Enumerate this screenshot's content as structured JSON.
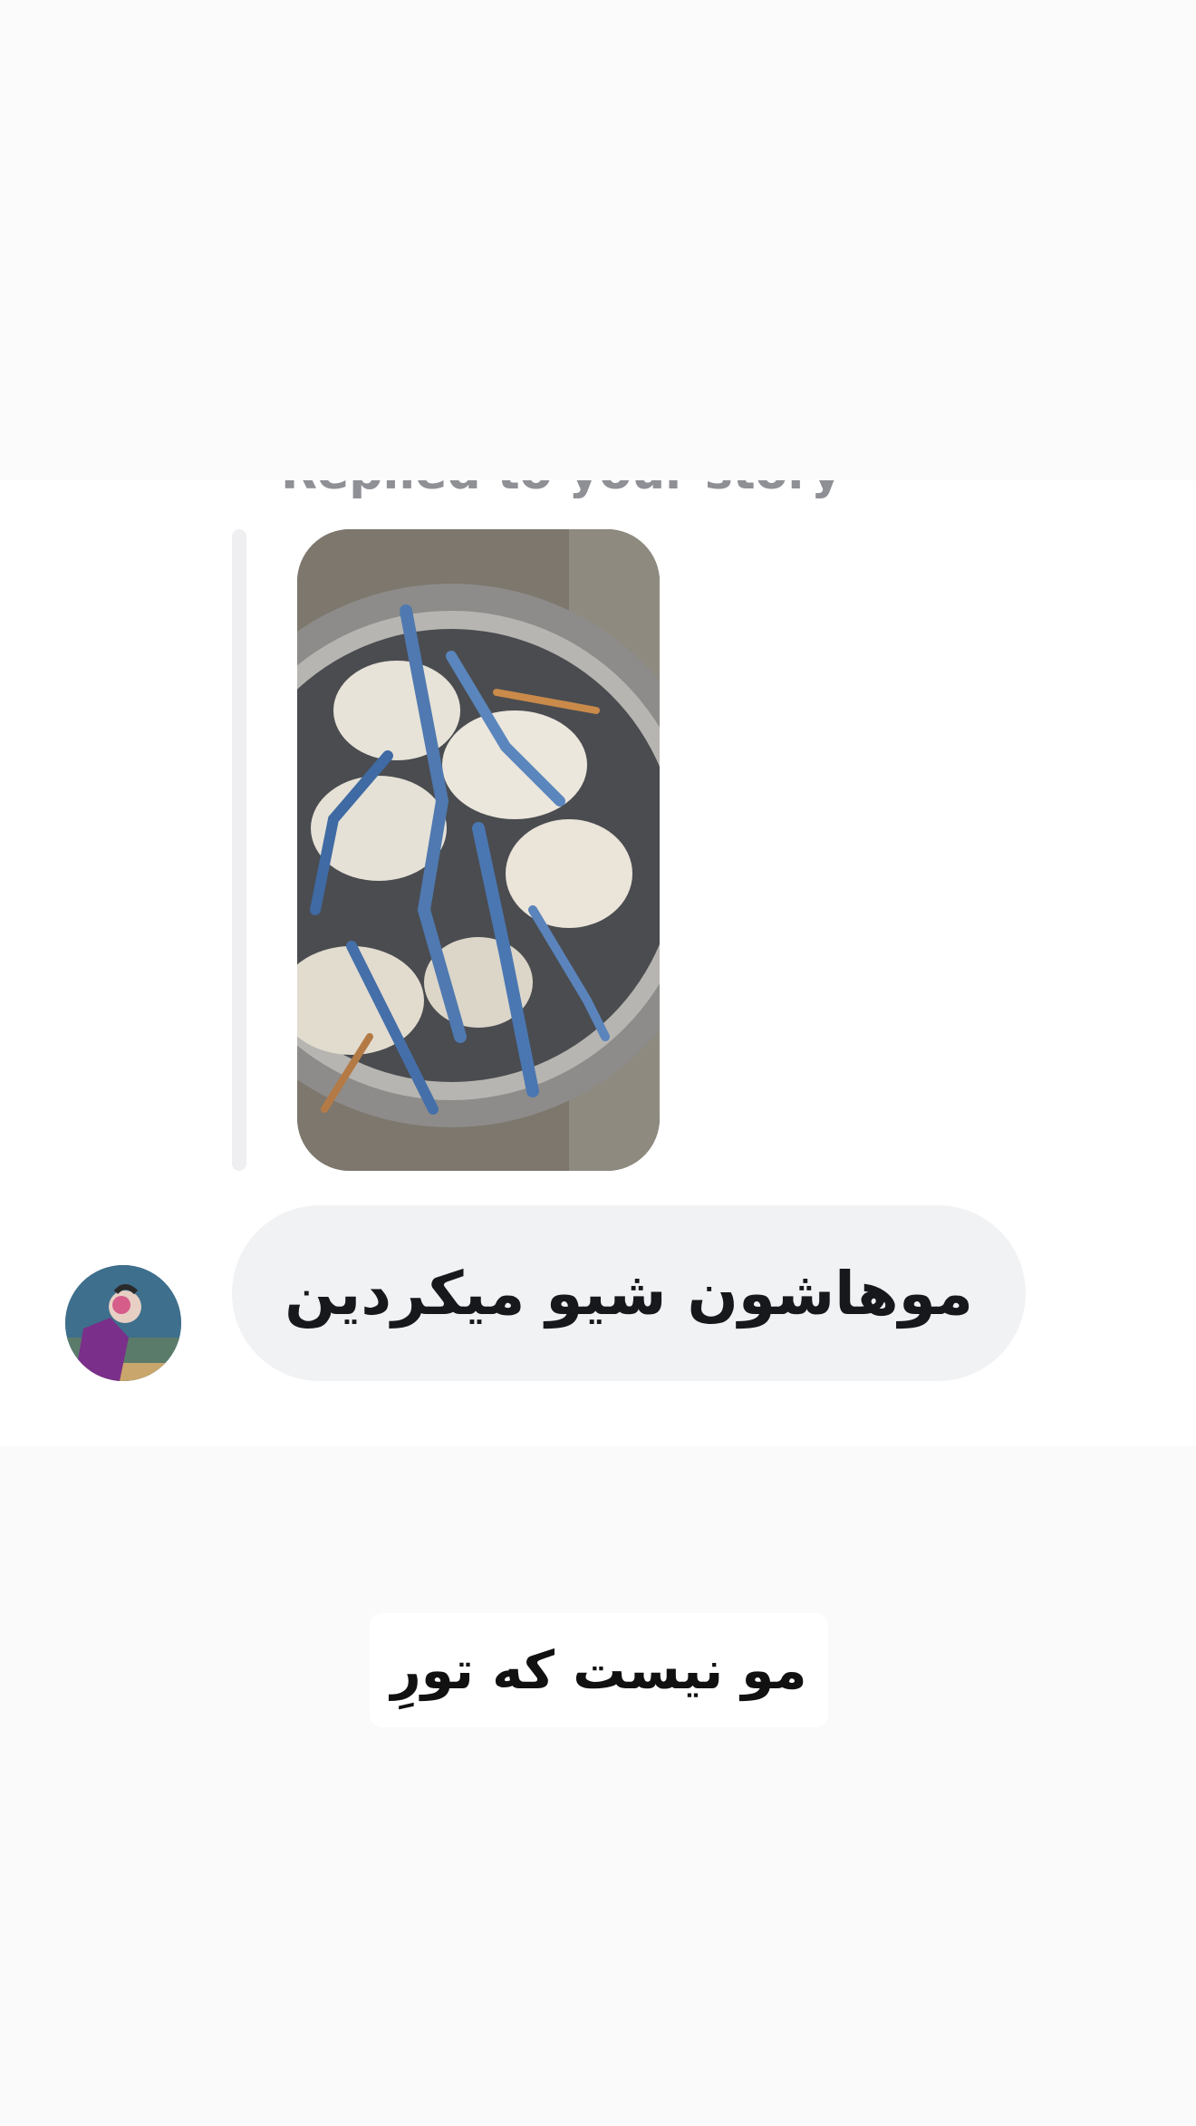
{
  "dm": {
    "replied_label": "Replied to your story",
    "story_thumbnail": "crabs-in-pot-photo",
    "avatar": "user-avatar-photo",
    "message_text": "موهاشون شیو میکردین"
  },
  "story": {
    "caption_text": "مو نیست که تورِ"
  },
  "colors": {
    "page_bg": "#fafafa",
    "panel_bg": "#ffffff",
    "bubble_bg": "#f1f2f4",
    "reply_bar": "#efeff1",
    "label_gray": "#8e9096"
  }
}
